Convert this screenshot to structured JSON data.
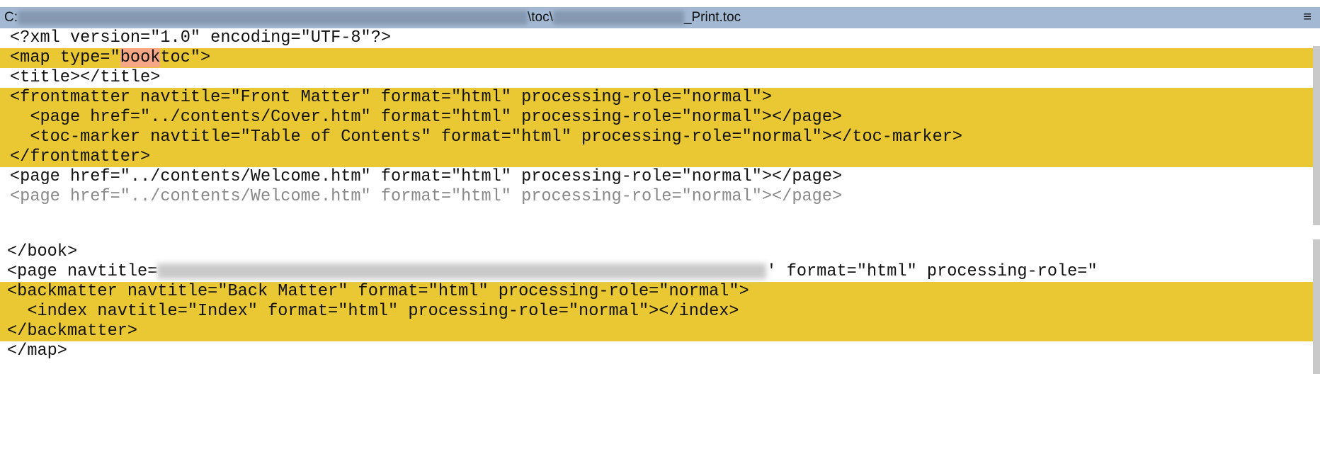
{
  "title": {
    "prefix": "C:",
    "middle": "\\toc\\",
    "suffix": "_Print.toc",
    "menu_icon": "≡"
  },
  "top_lines": [
    "<?xml version=\"1.0\" encoding=\"UTF-8\"?>",
    "<map type=\"",
    "book",
    "toc\">",
    "<title></title>",
    "<frontmatter navtitle=\"Front Matter\" format=\"html\" processing-role=\"normal\">",
    "  <page href=\"../contents/Cover.htm\" format=\"html\" processing-role=\"normal\"></page>",
    "  <toc-marker navtitle=\"Table of Contents\" format=\"html\" processing-role=\"normal\"></toc-marker>",
    "</frontmatter>",
    "<page href=\"../contents/Welcome.htm\" format=\"html\" processing-role=\"normal\"></page>"
  ],
  "bottom_lines": [
    "</book>",
    "<page navtitle=",
    "' format=\"html\" processing-role=\"",
    "<backmatter navtitle=\"Back Matter\" format=\"html\" processing-role=\"normal\">",
    "  <index navtitle=\"Index\" format=\"html\" processing-role=\"normal\"></index>",
    "</backmatter>",
    "</map>"
  ]
}
